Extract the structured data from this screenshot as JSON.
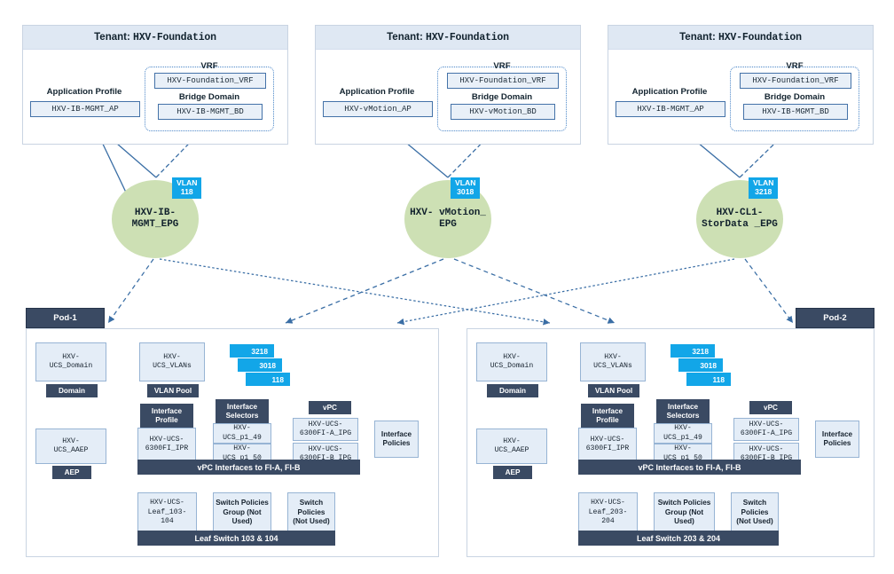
{
  "tenants": [
    {
      "header_prefix": "Tenant: ",
      "header_name": "HXV-Foundation",
      "app_profile_caption": "Application Profile",
      "app_profile_name": "HXV-IB-MGMT_AP",
      "vrf_caption": "VRF",
      "vrf_name": "HXV-Foundation_VRF",
      "bd_caption": "Bridge Domain",
      "bd_name": "HXV-IB-MGMT_BD"
    },
    {
      "header_prefix": "Tenant: ",
      "header_name": "HXV-Foundation",
      "app_profile_caption": "Application Profile",
      "app_profile_name": "HXV-vMotion_AP",
      "vrf_caption": "VRF",
      "vrf_name": "HXV-Foundation_VRF",
      "bd_caption": "Bridge Domain",
      "bd_name": "HXV-vMotion_BD"
    },
    {
      "header_prefix": "Tenant: ",
      "header_name": "HXV-Foundation",
      "app_profile_caption": "Application Profile",
      "app_profile_name": "HXV-IB-MGMT_AP",
      "vrf_caption": "VRF",
      "vrf_name": "HXV-Foundation_VRF",
      "bd_caption": "Bridge Domain",
      "bd_name": "HXV-IB-MGMT_BD"
    }
  ],
  "epgs": [
    {
      "name": "HXV-IB-\nMGMT_EPG",
      "vlan_label": "VLAN",
      "vlan_id": "118"
    },
    {
      "name": "HXV-\nvMotion_\nEPG",
      "vlan_label": "VLAN",
      "vlan_id": "3018"
    },
    {
      "name": "HXV-CL1-\nStorData\n_EPG",
      "vlan_label": "VLAN",
      "vlan_id": "3218"
    }
  ],
  "pods": [
    {
      "tag": "Pod-1",
      "domain_node": "HXV-\nUCS_Domain",
      "domain_tag": "Domain",
      "vlans_node": "HXV-\nUCS_VLANs",
      "vlanpool_tag": "VLAN Pool",
      "vlan_chips": [
        "3218",
        "3018",
        "118"
      ],
      "aaep_node": "HXV-\nUCS_AAEP",
      "aaep_tag": "AEP",
      "iprofile_tag": "Interface\nProfile",
      "iprofile_node": "HXV-UCS-\n6300FI_IPR",
      "iselectors_tag": "Interface\nSelectors",
      "iselector_a": "HXV-\nUCS_p1_49",
      "iselector_b": "HXV-\nUCS_p1_50",
      "vpc_tag": "vPC",
      "ipg_a": "HXV-UCS-\n6300FI-A_IPG",
      "ipg_b": "HXV-UCS-\n6300FI-B_IPG",
      "ipolicies_node": "Interface\nPolicies",
      "vpc_bar": "vPC Interfaces to FI-A, FI-B",
      "leaf_node": "HXV-UCS-\nLeaf_103-\n104",
      "swpolgroup_node": "Switch Policies\nGroup (Not\nUsed)",
      "swpol_node": "Switch\nPolicies\n(Not Used)",
      "leaf_bar": "Leaf Switch 103 & 104"
    },
    {
      "tag": "Pod-2",
      "domain_node": "HXV-\nUCS_Domain",
      "domain_tag": "Domain",
      "vlans_node": "HXV-\nUCS_VLANs",
      "vlanpool_tag": "VLAN Pool",
      "vlan_chips": [
        "3218",
        "3018",
        "118"
      ],
      "aaep_node": "HXV-\nUCS_AAEP",
      "aaep_tag": "AEP",
      "iprofile_tag": "Interface\nProfile",
      "iprofile_node": "HXV-UCS-\n6300FI_IPR",
      "iselectors_tag": "Interface\nSelectors",
      "iselector_a": "HXV-\nUCS_p1_49",
      "iselector_b": "HXV-\nUCS_p1_50",
      "vpc_tag": "vPC",
      "ipg_a": "HXV-UCS-\n6300FI-A_IPG",
      "ipg_b": "HXV-UCS-\n6300FI-B_IPG",
      "ipolicies_node": "Interface\nPolicies",
      "vpc_bar": "vPC Interfaces to FI-A, FI-B",
      "leaf_node": "HXV-UCS-\nLeaf_203-\n204",
      "swpolgroup_node": "Switch Policies\nGroup (Not\nUsed)",
      "swpol_node": "Switch\nPolicies\n(Not Used)",
      "leaf_bar": "Leaf Switch 203 & 204"
    }
  ],
  "colors": {
    "tenant_header": "#dfe8f3",
    "epg_fill": "#cde0b4",
    "vlan_badge": "#12a6e8",
    "dark_tag": "#3a4a63",
    "node_fill": "#e4edf7",
    "connector": "#4a86c8"
  }
}
